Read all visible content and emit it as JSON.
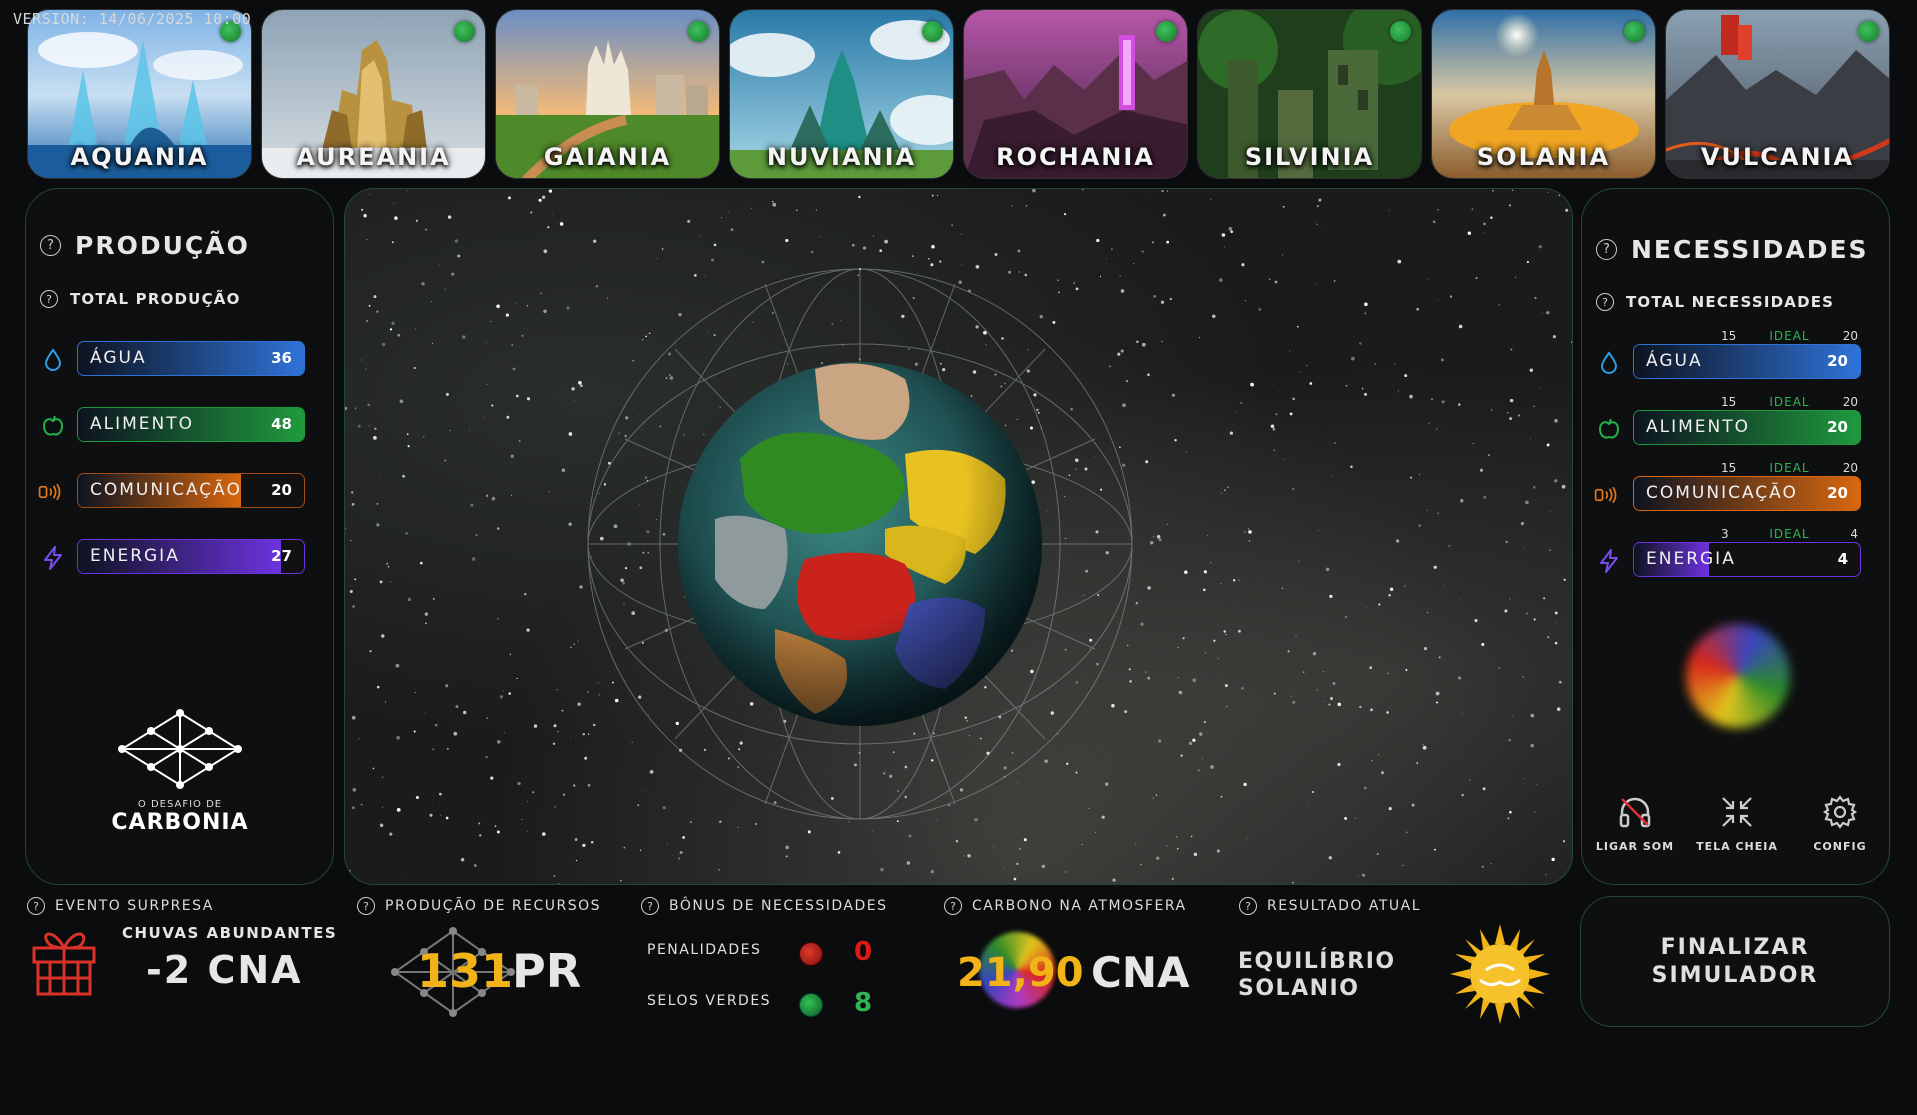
{
  "version": "VERSION: 14/06/2025 10:00",
  "worlds": [
    {
      "name": "AQUANIA",
      "icon": "aquania-world-image"
    },
    {
      "name": "AUREANIA",
      "icon": "aureania-world-image"
    },
    {
      "name": "GAIANIA",
      "icon": "gaiania-world-image"
    },
    {
      "name": "NUVIANIA",
      "icon": "nuviania-world-image"
    },
    {
      "name": "ROCHANIA",
      "icon": "rochania-world-image"
    },
    {
      "name": "SILVINIA",
      "icon": "silvinia-world-image"
    },
    {
      "name": "SOLANIA",
      "icon": "solania-world-image"
    },
    {
      "name": "VULCANIA",
      "icon": "vulcania-world-image"
    }
  ],
  "production": {
    "title": "PRODUÇÃO",
    "subtitle": "TOTAL PRODUÇÃO",
    "items": [
      {
        "label": "ÁGUA",
        "value": "36",
        "fill_pct": 100,
        "color": "#2f73d8"
      },
      {
        "label": "ALIMENTO",
        "value": "48",
        "fill_pct": 100,
        "color": "#1f9a3e"
      },
      {
        "label": "COMUNICAÇÃO",
        "value": "20",
        "fill_pct": 72,
        "color": "#d9670f"
      },
      {
        "label": "ENERGIA",
        "value": "27",
        "fill_pct": 90,
        "color": "#6d33e0"
      }
    ],
    "logo_small": "O DESAFIO DE",
    "logo_big": "CARBONIA"
  },
  "needs": {
    "title": "NECESSIDADES",
    "subtitle": "TOTAL NECESSIDADES",
    "items": [
      {
        "label": "ÁGUA",
        "value": "20",
        "min": "15",
        "ideal": "IDEAL",
        "max": "20",
        "fill_pct": 100,
        "color": "#2f73d8"
      },
      {
        "label": "ALIMENTO",
        "value": "20",
        "min": "15",
        "ideal": "IDEAL",
        "max": "20",
        "fill_pct": 100,
        "color": "#1f9a3e"
      },
      {
        "label": "COMUNICAÇÃO",
        "value": "20",
        "min": "15",
        "ideal": "IDEAL",
        "max": "20",
        "fill_pct": 100,
        "color": "#d9670f"
      },
      {
        "label": "ENERGIA",
        "value": "4",
        "min": "3",
        "ideal": "IDEAL",
        "max": "4",
        "fill_pct": 33,
        "color": "#6d33e0"
      }
    ]
  },
  "tools": {
    "sound": "LIGAR SOM",
    "fullscreen": "TELA CHEIA",
    "config": "CONFIG"
  },
  "bottom": {
    "event_head": "EVENTO SURPRESA",
    "event_name": "CHUVAS ABUNDANTES",
    "event_value": "-2 CNA",
    "prod_head": "PRODUÇÃO DE RECURSOS",
    "prod_value": "131",
    "prod_unit": "PR",
    "bonus_head": "BÔNUS DE NECESSIDADES",
    "penalties_label": "PENALIDADES",
    "penalties_value": "0",
    "green_label": "SELOS VERDES",
    "green_value": "8",
    "carbon_head": "CARBONO NA ATMOSFERA",
    "carbon_value": "21,90",
    "carbon_unit": "CNA",
    "result_head": "RESULTADO ATUAL",
    "result_line1": "EQUILÍBRIO",
    "result_line2": "SOLANIO",
    "finish_line1": "FINALIZAR",
    "finish_line2": "SIMULADOR"
  },
  "colors": {
    "accent_green": "#2fb552",
    "panel_border": "#1f4a33",
    "gold": "#f2b318",
    "penalty_red": "#e01818"
  }
}
